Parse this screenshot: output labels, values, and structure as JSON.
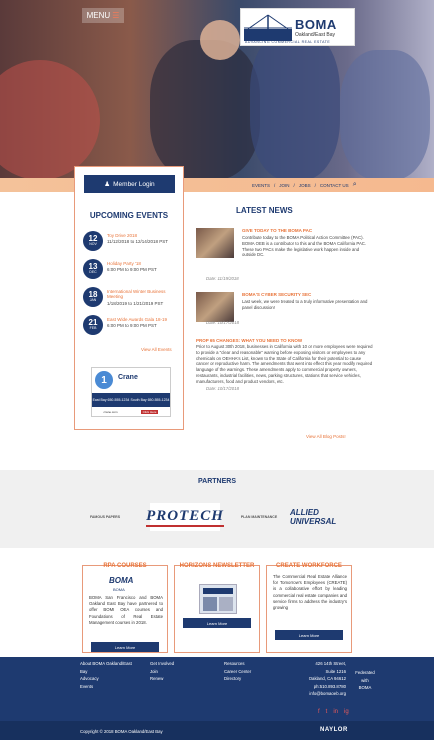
{
  "header": {
    "menu_label": "MENU",
    "logo": {
      "name": "BOMA",
      "sub": "Oakland/East Bay",
      "tagline": "ADVANCING COMMERCIAL REAL ESTATE"
    }
  },
  "nav": {
    "links": [
      "EVENTS",
      "JOIN",
      "JOBS",
      "CONTACT US"
    ]
  },
  "sidebar": {
    "login_label": "Member Login",
    "title": "UPCOMING EVENTS",
    "events": [
      {
        "day": "12",
        "month": "NOV",
        "name": "Toy Drive 2018",
        "time": "11/12/2018 to 12/14/2018 PST"
      },
      {
        "day": "13",
        "month": "DEC",
        "name": "Holiday Party '18",
        "time": "6:00 PM to 9:00 PM PST"
      },
      {
        "day": "18",
        "month": "JAN",
        "name": "International Winter Business Meeting",
        "time": "1/18/2019 to 1/21/2019 PST"
      },
      {
        "day": "21",
        "month": "FEB",
        "name": "East Wide Awards Gala 18-19",
        "time": "6:00 PM to 9:00 PM PST"
      }
    ],
    "view_all": "View All Events",
    "ad": {
      "number": "1",
      "brand": "Crane",
      "left_text": "East Bay 650-555-1234",
      "right_text": "South Bay 650-555-1234",
      "site": "crane.com",
      "cta": "Click Here"
    }
  },
  "latest": {
    "title": "LATEST NEWS",
    "items": [
      {
        "title": "GIVE TODAY TO THE BOMA PAC",
        "body": "Contribute today to the BOMA Political Action Committee (PAC). BOMA OEB is a contributor to this and the BOMA California PAC. These two PACs make the legislative work happen inside and outside DC.",
        "date": "Date: 11/19/2018"
      },
      {
        "title": "BOMA'S CYBER SECURITY SEC",
        "body": "Last week, we were treated to a truly informative presentation and panel discussion!",
        "date": "Date: 10/17/2018"
      },
      {
        "title": "PROP 65 CHANGES: WHAT YOU NEED TO KNOW",
        "body": "Prior to August 30th 2018, businesses in California with 10 or more employees were required to provide a \"clear and reasonable\" warning before exposing visitors or employees to any chemicals on OEHHA's List, known to the State of California for their potential to cause cancer or reproductive harm. The amendments that went into effect this year modify required language of the warnings. These amendments apply to commercial property owners, restaurants, industrial facilities, news, parking structures, stations that service vehicles, manufacturers, food and product vendors, etc.",
        "date": "Date: 10/17/2018"
      }
    ],
    "view_all": "View All Blog Posts!"
  },
  "partners": {
    "title": "PARTNERS",
    "logos": [
      "FAMOUS PAPERS",
      "PROTECH",
      "PLAN MAINTENANCE",
      "ALLIED UNIVERSAL"
    ]
  },
  "boxes": [
    {
      "title": "RPA COURSES",
      "body": "BOMA San Francisco and BOMA Oakland East Bay have partnered to offer BOMI OEA courses and Foundations of Real Estate Management courses in 2018.",
      "btn": "Learn More",
      "logo_top": "BOMA",
      "logo_bottom": "BOMA"
    },
    {
      "title": "HORIZONS NEWSLETTER",
      "btn": "Learn More"
    },
    {
      "title": "CREATE WORKFORCE",
      "body": "The Commercial Real Estate Alliance for Tomorrow's Employees (CREATE) is a collaborative effort by leading commercial real estate companies and service firms to address the industry's growing",
      "btn": "Learn More"
    }
  ],
  "footer": {
    "col1": [
      "About BOMA Oakland/East",
      "Bay",
      "Advocacy",
      "Events"
    ],
    "col2": [
      "Get Involved",
      "Join",
      "Renew"
    ],
    "col3": [
      "Resources",
      "Career Center",
      "Directory"
    ],
    "address": [
      "426 14th Street,",
      "Suite 1216",
      "Oakland, CA 94612",
      "ph:510.893.8780"
    ],
    "email": "info@bomaoeb.org",
    "fed": [
      "Federated",
      "with",
      "BOMA"
    ],
    "social": [
      "f",
      "t",
      "in",
      "ig"
    ]
  },
  "copyright": "Copyright © 2018 BOMA Oakland/East Bay",
  "naylor": "NAYLOR"
}
